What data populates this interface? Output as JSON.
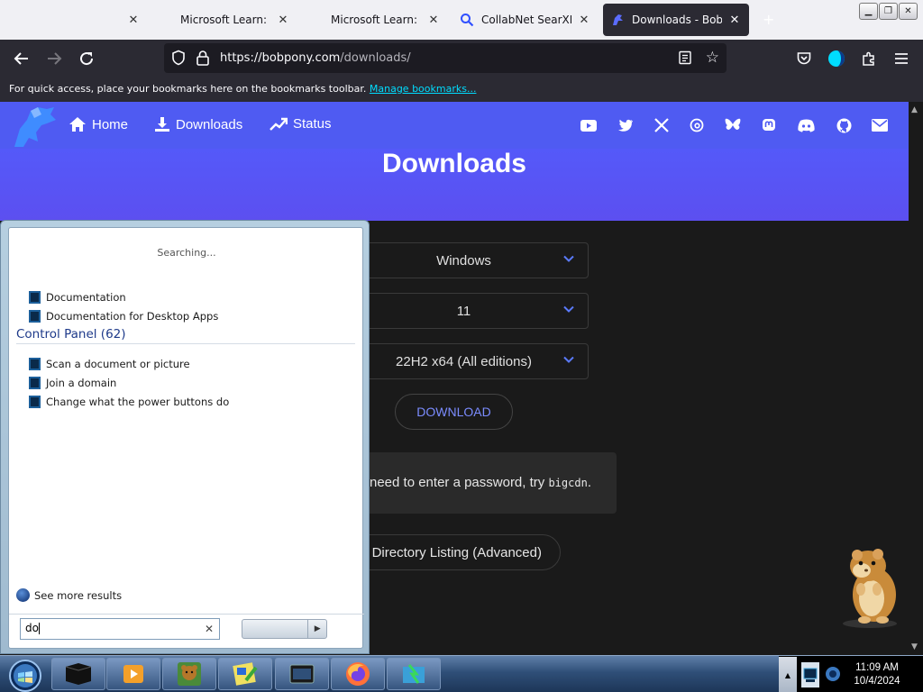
{
  "browser": {
    "tabs": [
      {
        "title": "Microsoft Learn: Bui",
        "icon": "microsoft-icon"
      },
      {
        "title": "Microsoft Learn: Bui",
        "icon": "microsoft-icon"
      },
      {
        "title": "CollabNet SearXNG",
        "icon": "search-icon"
      },
      {
        "title": "Downloads - Bob Po",
        "icon": "bobpony-icon",
        "active": true
      }
    ],
    "url": {
      "host": "https://bobpony.com",
      "path": "/downloads/"
    },
    "bookmarks_hint": "For quick access, place your bookmarks here on the bookmarks toolbar.",
    "bookmarks_link": "Manage bookmarks..."
  },
  "site": {
    "nav": [
      {
        "label": "Home",
        "icon": "home-icon"
      },
      {
        "label": "Downloads",
        "icon": "download-icon"
      },
      {
        "label": "Status",
        "icon": "trend-icon"
      }
    ],
    "social_icons": [
      "youtube-icon",
      "twitter-icon",
      "x-icon",
      "threads-icon",
      "bluesky-icon",
      "mastodon-icon",
      "discord-icon",
      "github-icon",
      "mail-icon"
    ],
    "title": "Downloads",
    "selects": {
      "os": "Windows",
      "version": "11",
      "edition": "22H2 x64 (All editions)"
    },
    "download_button": "DOWNLOAD",
    "notice_text": "need to enter a password, try",
    "notice_code": "bigcdn",
    "notice_end": ".",
    "directory_button": "Directory Listing (Advanced)"
  },
  "start_menu": {
    "status": "Searching...",
    "programs": [
      "Documentation",
      "Documentation for Desktop Apps"
    ],
    "control_panel_header": "Control Panel (62)",
    "control_panel_items": [
      "Scan a document or picture",
      "Join a domain",
      "Change what the power buttons do"
    ],
    "see_more": "See more results",
    "search_value": "do"
  },
  "taskbar": {
    "time": "11:09 AM",
    "date": "10/4/2024",
    "colors": {
      "accent": "#4f5bf2",
      "taskbar": "#2f4f78"
    }
  }
}
